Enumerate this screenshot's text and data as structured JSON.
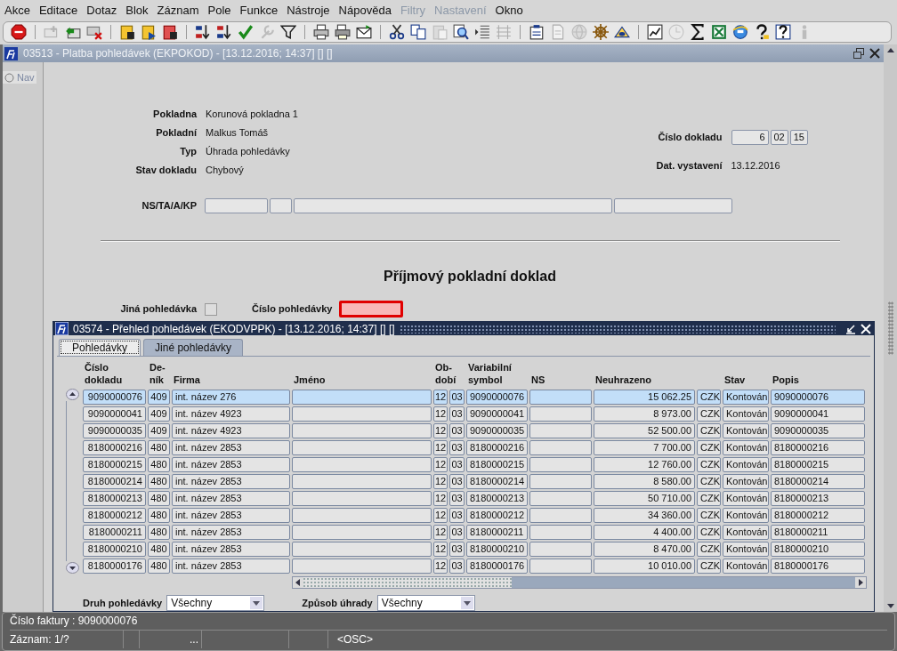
{
  "menu": [
    {
      "label": "Akce",
      "disabled": false
    },
    {
      "label": "Editace",
      "disabled": false
    },
    {
      "label": "Dotaz",
      "disabled": false
    },
    {
      "label": "Blok",
      "disabled": false
    },
    {
      "label": "Záznam",
      "disabled": false
    },
    {
      "label": "Pole",
      "disabled": false
    },
    {
      "label": "Funkce",
      "disabled": false
    },
    {
      "label": "Nástroje",
      "disabled": false
    },
    {
      "label": "Nápověda",
      "disabled": false
    },
    {
      "label": "Filtry",
      "disabled": true
    },
    {
      "label": "Nastavení",
      "disabled": true
    },
    {
      "label": "Okno",
      "disabled": false
    }
  ],
  "toolbar": [
    [
      {
        "disabled": false
      }
    ],
    [
      {
        "disabled": true
      },
      {
        "disabled": false
      },
      {
        "disabled": false
      }
    ],
    [
      {
        "disabled": false
      },
      {
        "disabled": false
      },
      {
        "disabled": false
      }
    ],
    [
      {
        "disabled": false
      },
      {
        "disabled": false
      },
      {
        "disabled": false
      },
      {
        "disabled": true
      },
      {
        "disabled": false
      }
    ],
    [
      {
        "disabled": false
      },
      {
        "disabled": false
      },
      {
        "disabled": false
      }
    ],
    [
      {
        "disabled": false
      },
      {
        "disabled": false
      },
      {
        "disabled": true
      },
      {
        "disabled": false
      },
      {
        "disabled": false
      },
      {
        "disabled": true
      }
    ],
    [
      {
        "disabled": false
      },
      {
        "disabled": true
      },
      {
        "disabled": true
      },
      {
        "disabled": false
      },
      {
        "disabled": false
      }
    ],
    [
      {
        "disabled": false
      },
      {
        "disabled": true
      },
      {
        "disabled": false
      },
      {
        "disabled": false
      },
      {
        "disabled": false
      },
      {
        "disabled": false
      },
      {
        "disabled": false
      },
      {
        "disabled": true
      }
    ]
  ],
  "window": {
    "title": "03513 - Platba pohledávek (EKPOKOD) - [13.12.2016; 14:37] [] []"
  },
  "nav": {
    "label": "Nav",
    "selected": false
  },
  "form": {
    "fields": [
      {
        "label": "Pokladna",
        "value": "Korunová pokladna 1"
      },
      {
        "label": "Pokladní",
        "value": "Malkus Tomáš"
      },
      {
        "label": "Typ",
        "value": "Úhrada pohledávky"
      },
      {
        "label": "Stav dokladu",
        "value": "Chybový"
      }
    ],
    "document_number": {
      "label": "Číslo dokladu",
      "parts": [
        "6",
        "02",
        "15"
      ]
    },
    "issue_date": {
      "label": "Dat. vystavení",
      "value": "13.12.2016"
    },
    "ns_ta_a_kp": {
      "label": "NS/TA/A/KP"
    },
    "heading": "Příjmový pokladní doklad",
    "other_claim": {
      "label": "Jiná pohledávka",
      "checked": false
    },
    "claim_number": {
      "label": "Číslo pohledávky",
      "error": true
    }
  },
  "subwindow": {
    "title": "03574 - Přehled pohledávek (EKODVPPK) - [13.12.2016; 14:37] [] []",
    "tabs": [
      {
        "label": "Pohledávky",
        "selected": true
      },
      {
        "label": "Jiné pohledávky",
        "selected": false
      }
    ],
    "columns": [
      "Číslo\ndokladu",
      "De-\nník",
      "Firma",
      "Jméno",
      "Ob-\ndobí",
      "Variabilní\nsymbol",
      "NS",
      "Neuhrazeno",
      "Stav",
      "Popis"
    ],
    "rows": [
      {
        "selected": true,
        "cells": [
          "9090000076",
          "409",
          "int. název 276",
          "12",
          "03",
          "9090000076",
          "15 062.25",
          "CZK",
          "Kontován",
          "9090000076"
        ]
      },
      {
        "selected": false,
        "cells": [
          "9090000041",
          "409",
          "int. název 4923",
          "12",
          "03",
          "9090000041",
          "8 973.00",
          "CZK",
          "Kontován",
          "9090000041"
        ]
      },
      {
        "selected": false,
        "cells": [
          "9090000035",
          "409",
          "int. název 4923",
          "12",
          "03",
          "9090000035",
          "52 500.00",
          "CZK",
          "Kontován",
          "9090000035"
        ]
      },
      {
        "selected": false,
        "cells": [
          "8180000216",
          "480",
          "int. název 2853",
          "12",
          "03",
          "8180000216",
          "7 700.00",
          "CZK",
          "Kontován",
          "8180000216"
        ]
      },
      {
        "selected": false,
        "cells": [
          "8180000215",
          "480",
          "int. název 2853",
          "12",
          "03",
          "8180000215",
          "12 760.00",
          "CZK",
          "Kontován",
          "8180000215"
        ]
      },
      {
        "selected": false,
        "cells": [
          "8180000214",
          "480",
          "int. název 2853",
          "12",
          "03",
          "8180000214",
          "8 580.00",
          "CZK",
          "Kontován",
          "8180000214"
        ]
      },
      {
        "selected": false,
        "cells": [
          "8180000213",
          "480",
          "int. název 2853",
          "12",
          "03",
          "8180000213",
          "50 710.00",
          "CZK",
          "Kontován",
          "8180000213"
        ]
      },
      {
        "selected": false,
        "cells": [
          "8180000212",
          "480",
          "int. název 2853",
          "12",
          "03",
          "8180000212",
          "34 360.00",
          "CZK",
          "Kontován",
          "8180000212"
        ]
      },
      {
        "selected": false,
        "cells": [
          "8180000211",
          "480",
          "int. název 2853",
          "12",
          "03",
          "8180000211",
          "4 400.00",
          "CZK",
          "Kontován",
          "8180000211"
        ]
      },
      {
        "selected": false,
        "cells": [
          "8180000210",
          "480",
          "int. název 2853",
          "12",
          "03",
          "8180000210",
          "8 470.00",
          "CZK",
          "Kontován",
          "8180000210"
        ]
      },
      {
        "selected": false,
        "cells": [
          "8180000176",
          "480",
          "int. název 2853",
          "12",
          "03",
          "8180000176",
          "10 010.00",
          "CZK",
          "Kontován",
          "8180000176"
        ]
      }
    ],
    "filters": [
      {
        "label": "Druh pohledávky",
        "value": "Všechny"
      },
      {
        "label": "Způsob úhrady",
        "value": "Všechny"
      }
    ]
  },
  "status": {
    "message": "Číslo faktury : 9090000076",
    "record": "Záznam: 1/?",
    "segment_4": "...",
    "segment_7": "<OSC>"
  }
}
